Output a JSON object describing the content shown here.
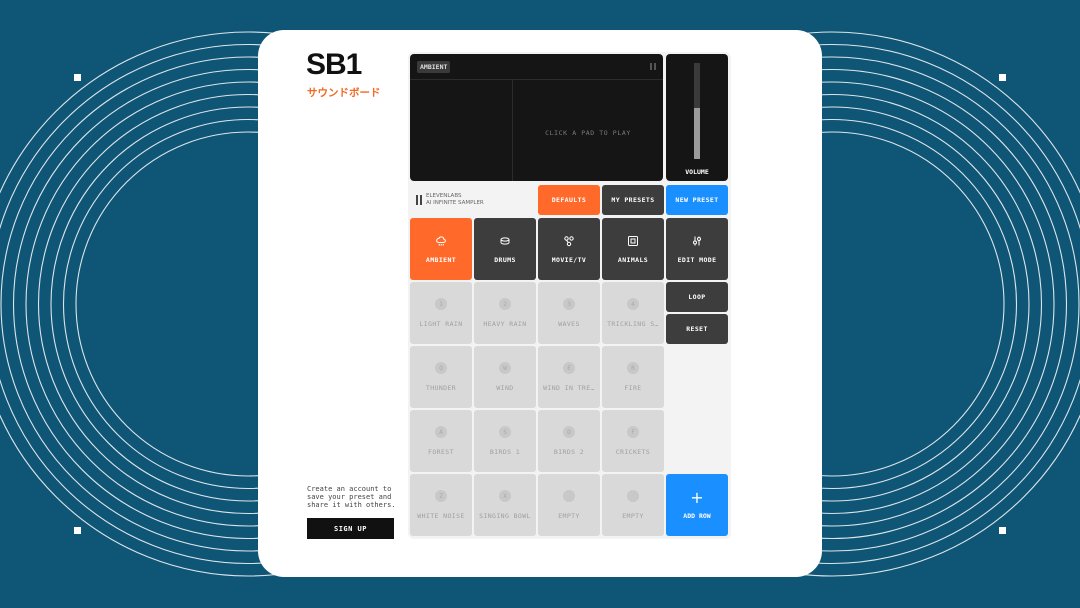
{
  "brand": {
    "logo": "SB1",
    "subtitle": "サウンドボード"
  },
  "display": {
    "active_category": "AMBIENT",
    "message": "CLICK A PAD TO PLAY",
    "volume_label": "VOLUME",
    "volume_level": 0.53
  },
  "credit": {
    "line1": "ELEVENLABS",
    "line2": "AI INFINITE SAMPLER"
  },
  "preset_buttons": {
    "defaults": "DEFAULTS",
    "my_presets": "MY PRESETS",
    "new_preset": "NEW PRESET"
  },
  "categories": [
    {
      "label": "AMBIENT",
      "icon": "cloud-rain-icon",
      "active": true
    },
    {
      "label": "DRUMS",
      "icon": "drum-icon",
      "active": false
    },
    {
      "label": "MOVIE/TV",
      "icon": "film-reel-icon",
      "active": false
    },
    {
      "label": "ANIMALS",
      "icon": "picture-icon",
      "active": false
    }
  ],
  "controls": {
    "edit_mode": "EDIT MODE",
    "loop": "LOOP",
    "reset": "RESET",
    "add_row": "ADD ROW"
  },
  "pads": [
    {
      "key": "1",
      "label": "LIGHT RAIN"
    },
    {
      "key": "2",
      "label": "HEAVY RAIN"
    },
    {
      "key": "3",
      "label": "WAVES"
    },
    {
      "key": "4",
      "label": "TRICKLING S…"
    },
    {
      "key": "Q",
      "label": "THUNDER"
    },
    {
      "key": "W",
      "label": "WIND"
    },
    {
      "key": "E",
      "label": "WIND IN TRE…"
    },
    {
      "key": "R",
      "label": "FIRE"
    },
    {
      "key": "A",
      "label": "FOREST"
    },
    {
      "key": "S",
      "label": "BIRDS 1"
    },
    {
      "key": "D",
      "label": "BIRDS 2"
    },
    {
      "key": "F",
      "label": "CRICKETS"
    },
    {
      "key": "Z",
      "label": "WHITE NOISE"
    },
    {
      "key": "X",
      "label": "SINGING BOWL"
    },
    {
      "key": "",
      "label": "EMPTY"
    },
    {
      "key": "",
      "label": "EMPTY"
    }
  ],
  "promo": {
    "text": "Create an account to save your preset and share it with others.",
    "signup": "SIGN UP"
  }
}
